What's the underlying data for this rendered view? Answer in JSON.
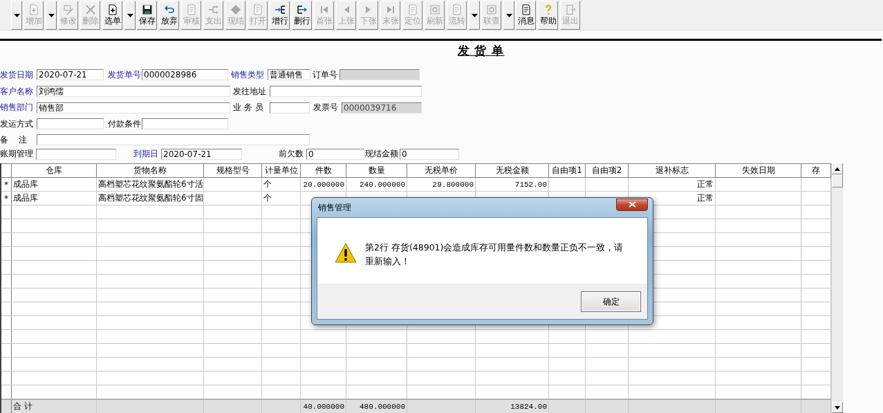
{
  "toolbar": [
    {
      "kind": "dropdown"
    },
    {
      "kind": "button",
      "label": "增加",
      "disabled": true
    },
    {
      "kind": "dropdown"
    },
    {
      "kind": "button",
      "label": "修改",
      "disabled": true
    },
    {
      "kind": "button",
      "label": "删除",
      "disabled": true
    },
    {
      "kind": "button",
      "label": "选单",
      "disabled": false
    },
    {
      "kind": "dropdown"
    },
    {
      "kind": "button",
      "label": "保存",
      "disabled": false
    },
    {
      "kind": "button",
      "label": "放弃",
      "disabled": false
    },
    {
      "kind": "button",
      "label": "审核",
      "disabled": true
    },
    {
      "kind": "button",
      "label": "支出",
      "disabled": true
    },
    {
      "kind": "button",
      "label": "现结",
      "disabled": true
    },
    {
      "kind": "button",
      "label": "打开",
      "disabled": true
    },
    {
      "kind": "button",
      "label": "增行",
      "disabled": false
    },
    {
      "kind": "button",
      "label": "删行",
      "disabled": false
    },
    {
      "kind": "button",
      "label": "首张",
      "disabled": true
    },
    {
      "kind": "button",
      "label": "上张",
      "disabled": true
    },
    {
      "kind": "button",
      "label": "下张",
      "disabled": true
    },
    {
      "kind": "button",
      "label": "末张",
      "disabled": true
    },
    {
      "kind": "button",
      "label": "定位",
      "disabled": true
    },
    {
      "kind": "button",
      "label": "刷新",
      "disabled": true
    },
    {
      "kind": "button",
      "label": "流转",
      "disabled": true
    },
    {
      "kind": "dropdown"
    },
    {
      "kind": "button",
      "label": "联查",
      "disabled": true
    },
    {
      "kind": "dropdown"
    },
    {
      "kind": "button",
      "label": "消息",
      "disabled": false
    },
    {
      "kind": "button",
      "label": "帮助",
      "disabled": false
    },
    {
      "kind": "button",
      "label": "退出",
      "disabled": true
    }
  ],
  "form": {
    "title": "发 货 单",
    "lines": [
      {
        "fields": [
          {
            "label": "发货日期",
            "required": true,
            "disabled": false,
            "value": "2020-07-21"
          },
          {
            "label": "发货单号",
            "required": true,
            "disabled": false,
            "value": "0000028986"
          },
          {
            "label": "销售类型",
            "required": true,
            "disabled": false,
            "value": "普通销售"
          },
          {
            "label": "订单号",
            "required": false,
            "disabled": true
          }
        ]
      },
      {
        "fields": [
          {
            "label": "客户名称",
            "required": true,
            "disabled": false,
            "value": "刘鸿儒"
          },
          {
            "label": "发往地址",
            "required": false,
            "disabled": false
          }
        ]
      },
      {
        "fields": [
          {
            "label": "销售部门",
            "required": true,
            "disabled": false,
            "value": "销售部"
          },
          {
            "label": "业 务 员",
            "required": false,
            "disabled": false
          },
          {
            "label": "发票号",
            "required": false,
            "disabled": true,
            "value": "0000039716"
          }
        ]
      },
      {
        "fields": [
          {
            "label": "发运方式",
            "required": false,
            "disabled": false
          },
          {
            "label": "付款条件",
            "required": false,
            "disabled": false
          }
        ]
      },
      {
        "fields": [
          {
            "label": "备    注",
            "required": false,
            "disabled": false
          }
        ]
      },
      {
        "fields": [
          {
            "label": "账期管理",
            "required": false,
            "disabled": false
          },
          {
            "label": "到期日",
            "required": true,
            "disabled": false,
            "value": "2020-07-21"
          },
          {
            "label": "前欠数",
            "required": false,
            "disabled": false,
            "value": "0"
          },
          {
            "label": "现结金额",
            "required": false,
            "disabled": false,
            "value": "0"
          }
        ]
      }
    ]
  },
  "grid": {
    "columns": [
      "仓库",
      "货物名称",
      "规格型号",
      "计量单位",
      "件数",
      "数量",
      "无税单价",
      "无税金额",
      "自由项1",
      "自由项2",
      "退补标志",
      "失效日期",
      "存"
    ],
    "rows": [
      {
        "marker": "*",
        "warehouse": "成品库",
        "goods_name": "高档塑芯花纹聚氨酯轮6寸活",
        "unit": "个",
        "pieces": "20.000000",
        "quantity": "240.000000",
        "unit_price": "29.800000",
        "amount": "7152.00",
        "refund_flag": "正常"
      },
      {
        "marker": "*",
        "warehouse": "成品库",
        "goods_name": "高档塑芯花纹聚氨酯轮6寸固",
        "unit": "个",
        "refund_flag": "正常"
      }
    ],
    "totals": {
      "label": "合 计",
      "pieces": "40.000000",
      "quantity": "480.000000",
      "amount": "13824.00"
    }
  },
  "dialog": {
    "title": "销售管理",
    "message": "第2行 存货(48901)会造成库存可用量件数和数量正负不一致，请重新输入！",
    "buttons": [
      "确定"
    ]
  }
}
